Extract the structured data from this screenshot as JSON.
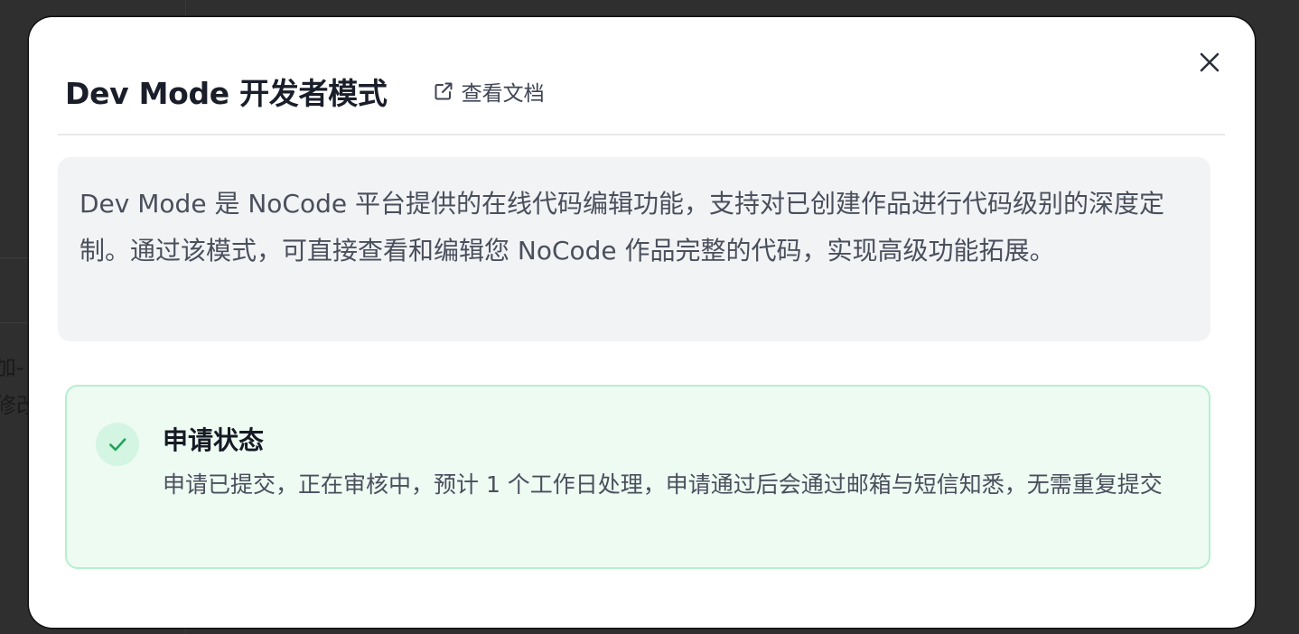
{
  "background": {
    "partial_text_line1": "加-",
    "partial_text_line2": "修改"
  },
  "modal": {
    "title": "Dev Mode 开发者模式",
    "doc_link_label": "查看文档",
    "doc_link_icon": "external-link-icon",
    "close_icon": "close-icon",
    "intro_text": "Dev Mode 是 NoCode 平台提供的在线代码编辑功能，支持对已创建作品进行代码级别的深度定制。通过该模式，可直接查看和编辑您 NoCode 作品完整的代码，实现高级功能拓展。",
    "status": {
      "icon": "check-icon",
      "title": "申请状态",
      "description": "申请已提交，正在审核中，预计 1 个工作日处理，申请通过后会通过邮箱与短信知悉，无需重复提交"
    }
  },
  "colors": {
    "success_green": "#22a559",
    "status_bg": "#edfbf3",
    "status_border": "#b7efcf"
  }
}
